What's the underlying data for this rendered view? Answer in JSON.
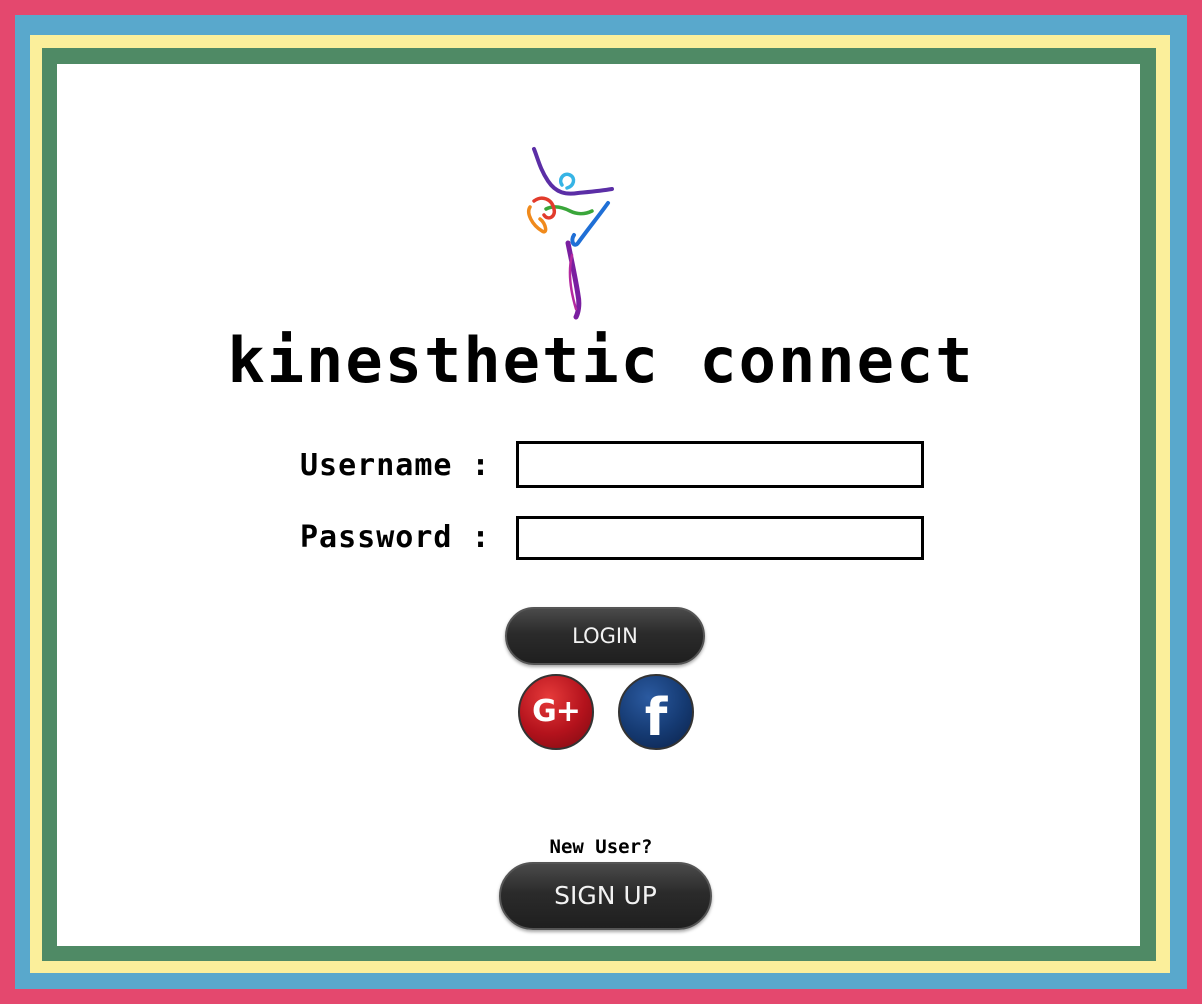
{
  "app": {
    "title": "kinesthetic connect",
    "logo_icon": "dancer-logo-icon"
  },
  "colors": {
    "border_outer": "#e4486e",
    "border_blue": "#59a8cc",
    "border_yellow": "#fbef9b",
    "border_green": "#4f8a65",
    "panel": "#ffffff",
    "button_dark": "#2b2b2b",
    "google_red": "#b3121c",
    "facebook_blue": "#153a72"
  },
  "login_form": {
    "username_label": "Username :",
    "username_value": "",
    "password_label": "Password :",
    "password_value": "",
    "login_button": "LOGIN"
  },
  "social": {
    "google_plus": {
      "label": "G+",
      "icon": "google-plus-icon"
    },
    "facebook": {
      "label": "f",
      "icon": "facebook-icon"
    }
  },
  "signup": {
    "prompt": "New User?",
    "button": "SIGN UP"
  }
}
